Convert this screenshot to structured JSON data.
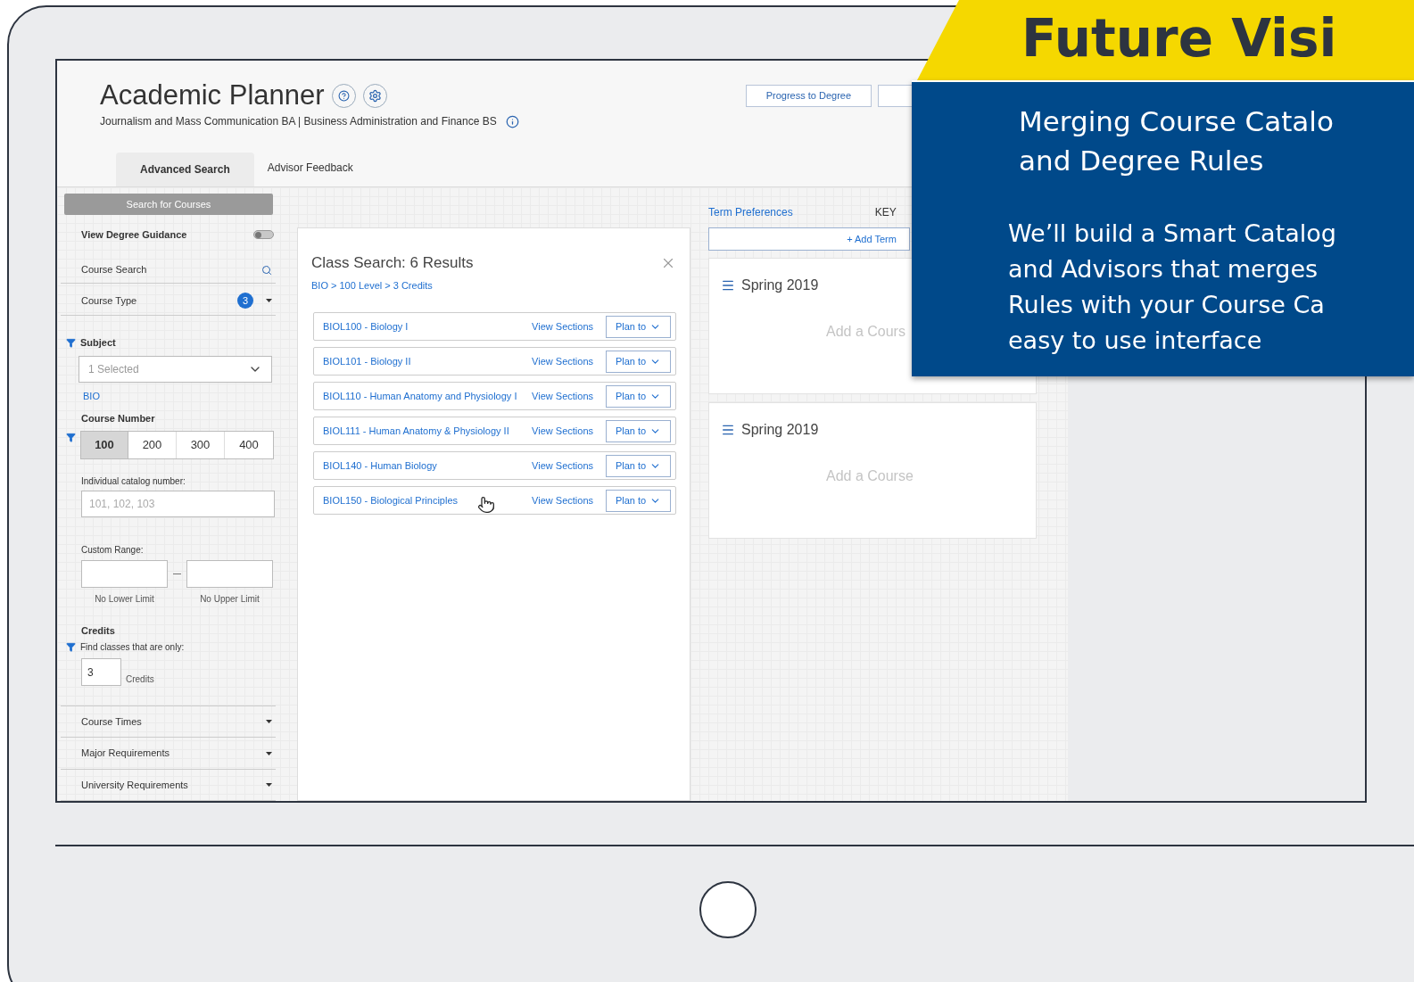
{
  "banner": {
    "title": "Future Visi"
  },
  "callout": {
    "heading_lines": [
      "Merging Course Catalo",
      "and Degree Rules"
    ],
    "body_lines": [
      "We’ll build a Smart Catalog",
      "and Advisors that merges",
      "Rules with your Course Ca",
      "easy to use interface"
    ]
  },
  "app": {
    "title": "Academic Planner",
    "subtitle": "Journalism and Mass Communication BA | Business Administration and Finance BS",
    "header_buttons": [
      "Progress to Degree"
    ],
    "tabs": [
      {
        "label": "Advanced Search",
        "selected": true
      },
      {
        "label": "Advisor Feedback",
        "selected": false
      }
    ],
    "sidebar": {
      "search_button": "Search for Courses",
      "degree_guidance": {
        "label": "View Degree Guidance",
        "on": false
      },
      "course_search": "Course Search",
      "course_type": {
        "label": "Course Type",
        "count": "3"
      },
      "subject": {
        "label": "Subject",
        "dropdown_value": "1 Selected",
        "tag": "BIO"
      },
      "course_number": {
        "label": "Course Number",
        "levels": [
          {
            "label": "100",
            "selected": true
          },
          {
            "label": "200",
            "selected": false
          },
          {
            "label": "300",
            "selected": false
          },
          {
            "label": "400",
            "selected": false
          }
        ]
      },
      "catalog_number": {
        "label": "Individual catalog number:",
        "placeholder": "101, 102, 103"
      },
      "custom_range": {
        "label": "Custom Range:",
        "lower_caption": "No Lower Limit",
        "upper_caption": "No Upper Limit"
      },
      "credits": {
        "label": "Credits",
        "hint": "Find classes that are only:",
        "value": "3",
        "unit": "Credits"
      },
      "sections": [
        "Course Times",
        "Major Requirements",
        "University Requirements"
      ]
    },
    "results": {
      "title": "Class Search: 6 Results",
      "breadcrumb": "BIO > 100 Level > 3 Credits",
      "rows": [
        {
          "course": "BIOL100 - Biology I",
          "link": "View Sections",
          "action": "Plan to"
        },
        {
          "course": "BIOL101 - Biology II",
          "link": "View Sections",
          "action": "Plan to"
        },
        {
          "course": "BIOL110 - Human Anatomy and Physiology I",
          "link": "View Sections",
          "action": "Plan to"
        },
        {
          "course": "BIOL111 - Human Anatomy & Physiology II",
          "link": "View Sections",
          "action": "Plan to"
        },
        {
          "course": "BIOL140 - Human Biology",
          "link": "View Sections",
          "action": "Plan to"
        },
        {
          "course": "BIOL150 - Biological Principles",
          "link": "View Sections",
          "action": "Plan to"
        }
      ]
    },
    "planner": {
      "term_preferences": "Term Preferences",
      "key_label": "KEY",
      "add_term": "+ Add Term",
      "terms": [
        {
          "name": "Spring 2019",
          "placeholder": "Add a Cours"
        },
        {
          "name": "Spring 2019",
          "placeholder": "Add a Course"
        }
      ]
    }
  }
}
